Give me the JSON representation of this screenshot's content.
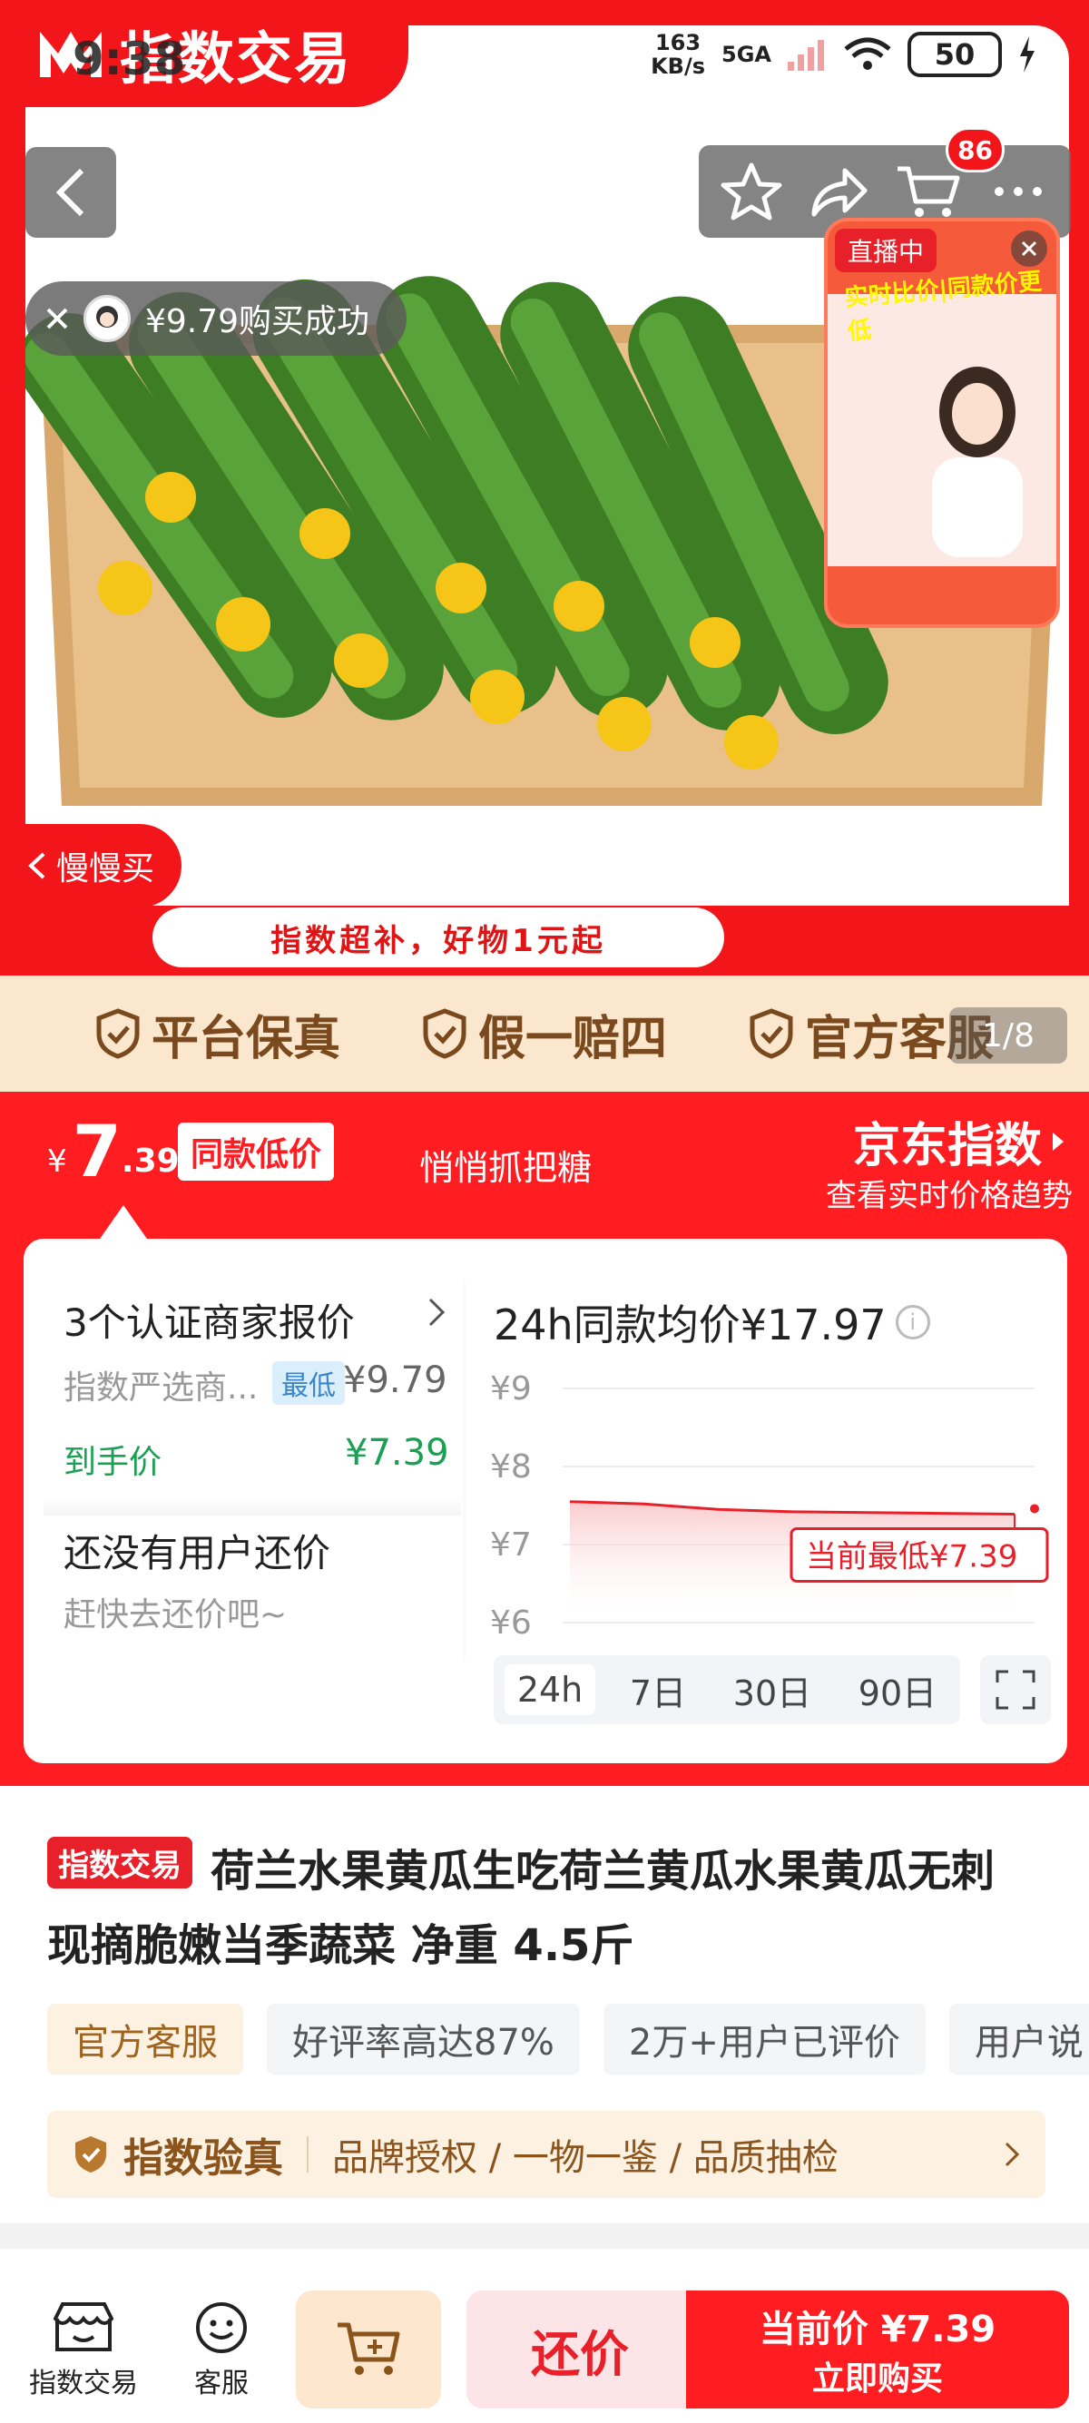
{
  "status_bar": {
    "time": "9:38",
    "net_speed_value": "163",
    "net_speed_unit": "KB/s",
    "network": "5GA",
    "battery": "50"
  },
  "brand": {
    "logo_text": "指数交易"
  },
  "header": {
    "cart_count": "86"
  },
  "toast": {
    "text": "¥9.79购买成功"
  },
  "live_card": {
    "badge": "直播中",
    "headline": "实时比价|同款价更低"
  },
  "hero": {
    "slow_buy": "慢慢买",
    "subsidy": "指数超补，好物1元起",
    "image_counter": "1/8"
  },
  "guarantees": [
    "平台保真",
    "假一赔四",
    "官方客服"
  ],
  "price": {
    "currency": "¥",
    "integer": "7",
    "decimal": ".39",
    "same_low_tag": "同款低价",
    "marketing": "悄悄抓把糖",
    "jd_index": "京东指数",
    "jd_sub": "查看实时价格趋势"
  },
  "sellers": {
    "title": "3个认证商家报价",
    "seller_name": "指数严选商...",
    "lowest_tag": "最低",
    "seller_price": "¥9.79",
    "hand_label": "到手价",
    "hand_price": "¥7.39",
    "no_bargain": "还没有用户还价",
    "bargain_hint": "赶快去还价吧~"
  },
  "trend": {
    "title": "24h同款均价¥17.97",
    "tabs": [
      "24h",
      "7日",
      "30日",
      "90日"
    ],
    "active_tab": 0,
    "annotation": "当前最低¥7.39"
  },
  "chart_data": {
    "type": "area",
    "title": "24h同款均价¥17.97",
    "x": [
      0,
      1,
      2,
      3,
      4,
      5,
      6
    ],
    "values": [
      7.55,
      7.52,
      7.45,
      7.42,
      7.41,
      7.4,
      7.39
    ],
    "ylim": [
      6,
      9
    ],
    "yticks": [
      "¥9",
      "¥8",
      "¥7",
      "¥6"
    ],
    "ytick_values": [
      9,
      8,
      7,
      6
    ],
    "grid": true,
    "annotation": "当前最低¥7.39",
    "line_color": "#e8202a"
  },
  "product": {
    "brand_tag": "指数交易",
    "title_line1": "荷兰水果黄瓜生吃荷兰黄瓜水果黄瓜无刺",
    "title_line2": "现摘脆嫩当季蔬菜 净重 4.5斤",
    "chips": [
      "官方客服",
      "好评率高达87%",
      "2万+用户已评价",
      "用户说"
    ],
    "verify_title": "指数验真",
    "verify_items": "品牌授权 / 一物一鉴 / 品质抽检"
  },
  "bottom_bar": {
    "store": "指数交易",
    "service": "客服",
    "bargain": "还价",
    "buy_price": "当前价 ¥7.39",
    "buy_label": "立即购买"
  },
  "colors": {
    "accent": "#ff1d22",
    "gold": "#8a541c",
    "green": "#1aa052"
  }
}
